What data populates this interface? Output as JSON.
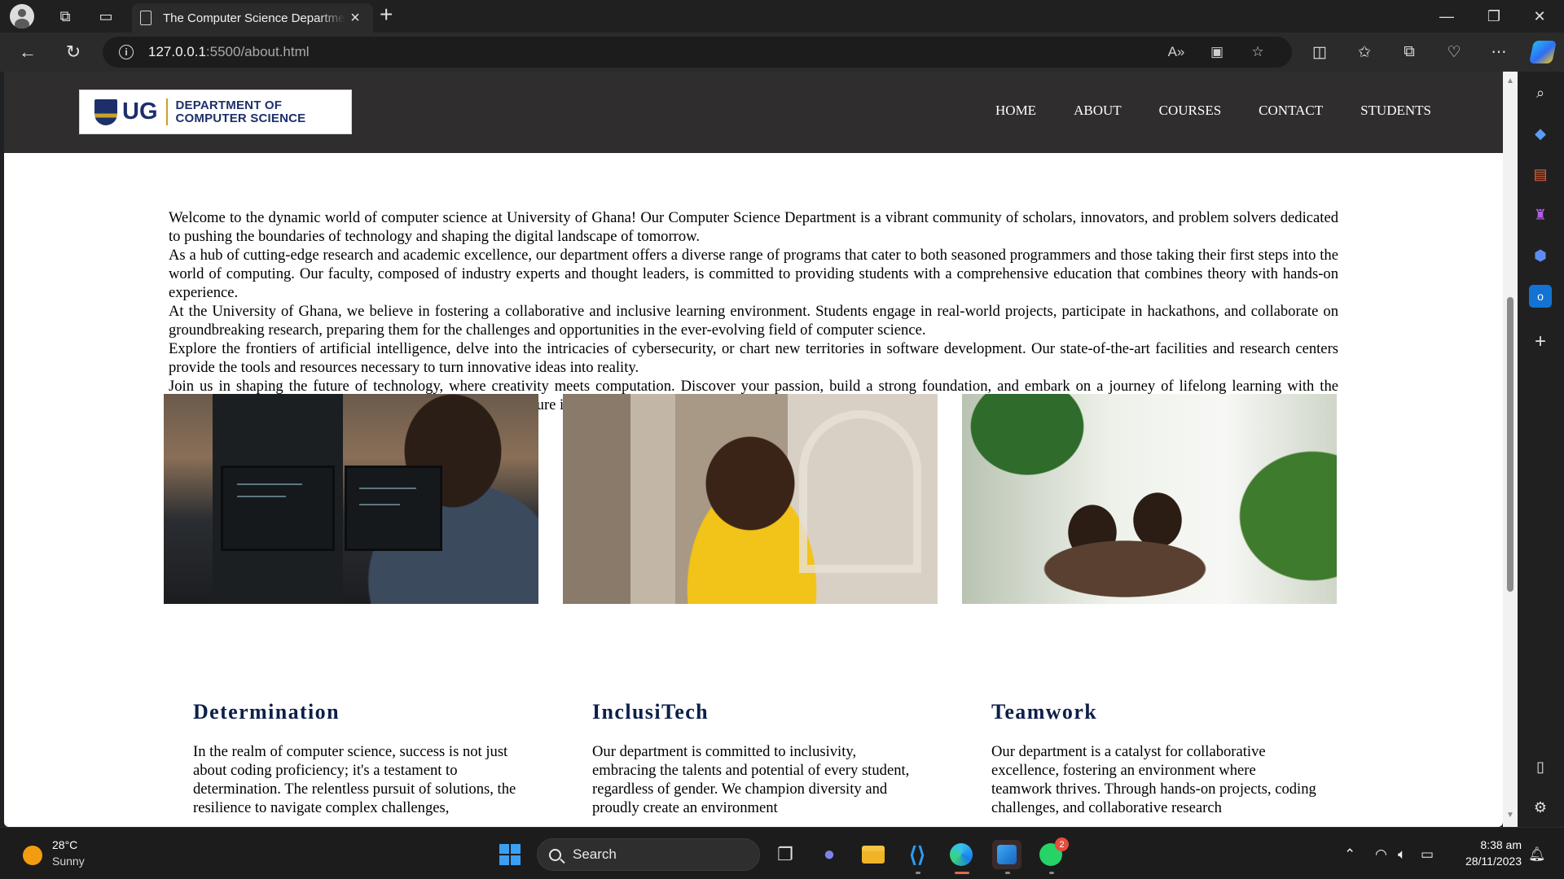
{
  "browser": {
    "tab_title": "The Computer Science Department",
    "url_host": "127.0.0.1",
    "url_path": ":5500/about.html"
  },
  "site": {
    "logo_ug": "UG",
    "logo_dept_line1": "DEPARTMENT OF",
    "logo_dept_line2": "COMPUTER SCIENCE",
    "nav": [
      "HOME",
      "ABOUT",
      "COURSES",
      "CONTACT",
      "STUDENTS"
    ],
    "intro": [
      "Welcome to the dynamic world of computer science at University of Ghana! Our Computer Science Department is a vibrant community of scholars, innovators, and problem solvers dedicated to pushing the boundaries of technology and shaping the digital landscape of tomorrow.",
      "As a hub of cutting-edge research and academic excellence, our department offers a diverse range of programs that cater to both seasoned programmers and those taking their first steps into the world of computing. Our faculty, composed of industry experts and thought leaders, is committed to providing students with a comprehensive education that combines theory with hands-on experience.",
      "At the University of Ghana, we believe in fostering a collaborative and inclusive learning environment. Students engage in real-world projects, participate in hackathons, and collaborate on groundbreaking research, preparing them for the challenges and opportunities in the ever-evolving field of computer science.",
      "Explore the frontiers of artificial intelligence, delve into the intricacies of cybersecurity, or chart new territories in software development. Our state-of-the-art facilities and research centers provide the tools and resources necessary to turn innovative ideas into reality.",
      "Join us in shaping the future of technology, where creativity meets computation. Discover your passion, build a strong foundation, and embark on a journey of lifelong learning with the Computer Science Department at the university. Your adventure in code begins here!"
    ],
    "cards": [
      {
        "title": "Determination",
        "text": "In the realm of computer science, success is not just about coding proficiency; it's a testament to determination. The relentless pursuit of solutions, the resilience to navigate complex challenges,"
      },
      {
        "title": "InclusiTech",
        "text": "Our department is committed to inclusivity, embracing the talents and potential of every student, regardless of gender. We champion diversity and proudly create an environment"
      },
      {
        "title": "Teamwork",
        "text": "Our department is a catalyst for collaborative excellence, fostering an environment where teamwork thrives. Through hands-on projects, coding challenges, and collaborative research"
      }
    ]
  },
  "taskbar": {
    "weather_temp": "28°C",
    "weather_cond": "Sunny",
    "search_label": "Search",
    "whatsapp_badge": "2",
    "time": "8:38 am",
    "date": "28/11/2023"
  },
  "colors": {
    "header_bg": "#2f2d2d",
    "brand_navy": "#0d1f4a",
    "ug_gold": "#c9a227"
  }
}
